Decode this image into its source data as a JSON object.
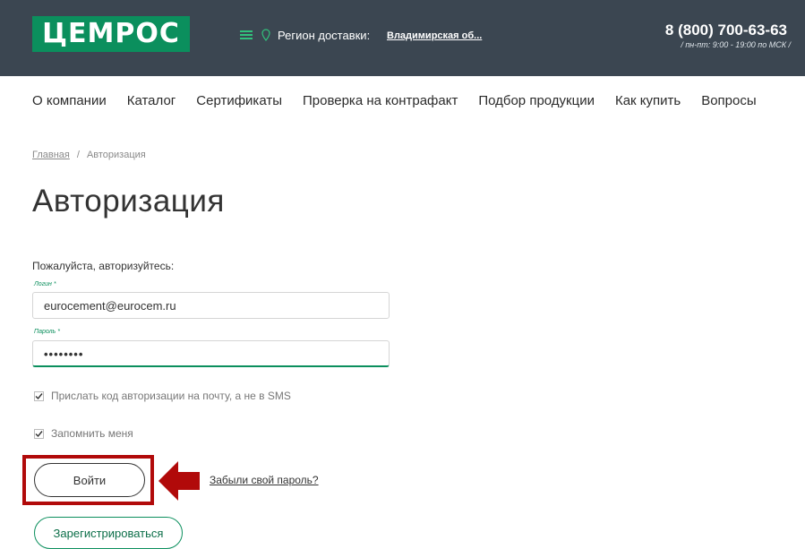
{
  "header": {
    "logo_text": "ЦЕМРОС",
    "region_label": "Регион доставки:",
    "region_value": "Владимирская об...",
    "phone": "8 (800) 700-63-63",
    "hours": "/ пн-пт: 9:00 - 19:00 по МСК /"
  },
  "nav": {
    "items": [
      "О компании",
      "Каталог",
      "Сертификаты",
      "Проверка на контрафакт",
      "Подбор продукции",
      "Как купить",
      "Вопросы"
    ]
  },
  "breadcrumb": {
    "home": "Главная",
    "separator": "/",
    "current": "Авторизация"
  },
  "page": {
    "title": "Авторизация",
    "intro": "Пожалуйста, авторизуйтесь:"
  },
  "form": {
    "login_label": "Логин",
    "login_value": "eurocement@eurocem.ru",
    "password_label": "Пароль",
    "password_value": "••••••••",
    "required_mark": "*",
    "email_code_label": "Прислать код авторизации на почту, а не в SMS",
    "remember_label": "Запомнить меня",
    "login_button": "Войти",
    "forgot_link": "Забыли свой пароль?",
    "register_button": "Зарегистрироваться"
  },
  "colors": {
    "header_bg": "#3b4651",
    "brand_green": "#0b8f5d",
    "highlight_red": "#b10a0a"
  }
}
